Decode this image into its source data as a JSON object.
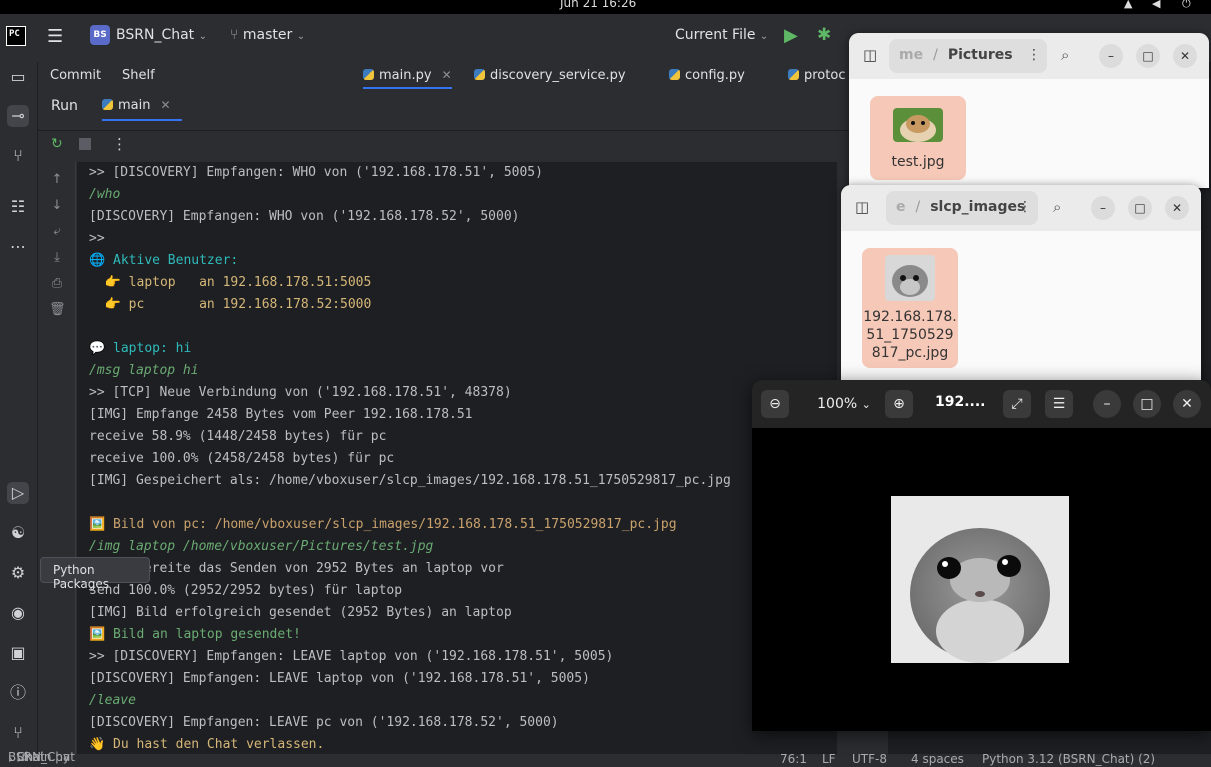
{
  "system_bar": {
    "clock": "Jun 21 16:26"
  },
  "header": {
    "project_badge": "BS",
    "project_name": "BSRN_Chat",
    "branch": "master",
    "run_config": "Current File"
  },
  "side_panel_tabs": {
    "commit": "Commit",
    "shelf": "Shelf"
  },
  "editor_tabs": [
    "main.py",
    "discovery_service.py",
    "config.py",
    "protoc"
  ],
  "run_panel": {
    "title": "Run",
    "tab": "main"
  },
  "tooltip": "Python Packages",
  "console_lines": [
    ">> [DISCOVERY] Empfangen: WHO von ('192.168.178.51', 5005)",
    "/who",
    "[DISCOVERY] Empfangen: WHO von ('192.168.178.52', 5000)",
    ">>",
    "🌐 Aktive Benutzer:",
    "  👉 laptop   an 192.168.178.51:5005",
    "  👉 pc       an 192.168.178.52:5000",
    "",
    "💬 laptop: hi",
    "/msg laptop hi",
    ">> [TCP] Neue Verbindung von ('192.168.178.51', 48378)",
    "[IMG] Empfange 2458 Bytes vom Peer 192.168.178.51",
    "receive 58.9% (1448/2458 bytes) für pc",
    "receive 100.0% (2458/2458 bytes) für pc",
    "[IMG] Gespeichert als: /home/vboxuser/slcp_images/192.168.178.51_1750529817_pc.jpg",
    "",
    "🖼️ Bild von pc: /home/vboxuser/slcp_images/192.168.178.51_1750529817_pc.jpg",
    "/img laptop /home/vboxuser/Pictures/test.jpg",
    "[IMG] Bereite das Senden von 2952 Bytes an laptop vor",
    "send 100.0% (2952/2952 bytes) für laptop",
    "[IMG] Bild erfolgreich gesendet (2952 Bytes) an laptop",
    "🖼️ Bild an laptop gesendet!",
    ">> [DISCOVERY] Empfangen: LEAVE laptop von ('192.168.178.51', 5005)",
    "[DISCOVERY] Empfangen: LEAVE laptop von ('192.168.178.51', 5005)",
    "/leave",
    "[DISCOVERY] Empfangen: LEAVE pc von ('192.168.178.52', 5000)",
    "👋 Du hast den Chat verlassen."
  ],
  "status_bar": {
    "breadcrumb": [
      "BSRN_Chat",
      "Chat",
      "main.py"
    ],
    "position": "76:1",
    "line_sep": "LF",
    "encoding": "UTF-8",
    "indent": "4 spaces",
    "interpreter": "Python 3.12 (BSRN_Chat) (2)"
  },
  "pictures_window": {
    "path_prefix": "me",
    "path_current": "Pictures",
    "file_name": "test.jpg"
  },
  "slcp_window": {
    "path_prefix": "e",
    "path_current": "slcp_images",
    "file_name": "192.168.178.51_1750529817_pc.jpg",
    "file_name_lines": [
      "192.168.178.",
      "51_1750529",
      "817_pc.jpg"
    ]
  },
  "viewer": {
    "zoom": "100%",
    "title": "192...."
  },
  "colors": {
    "ide_bg": "#1e1f22",
    "panel_bg": "#2b2d30",
    "console_green": "#6aab73",
    "console_cyan": "#2fbaba",
    "console_yellow": "#d5b778",
    "file_tile": "#f6c8b8"
  }
}
